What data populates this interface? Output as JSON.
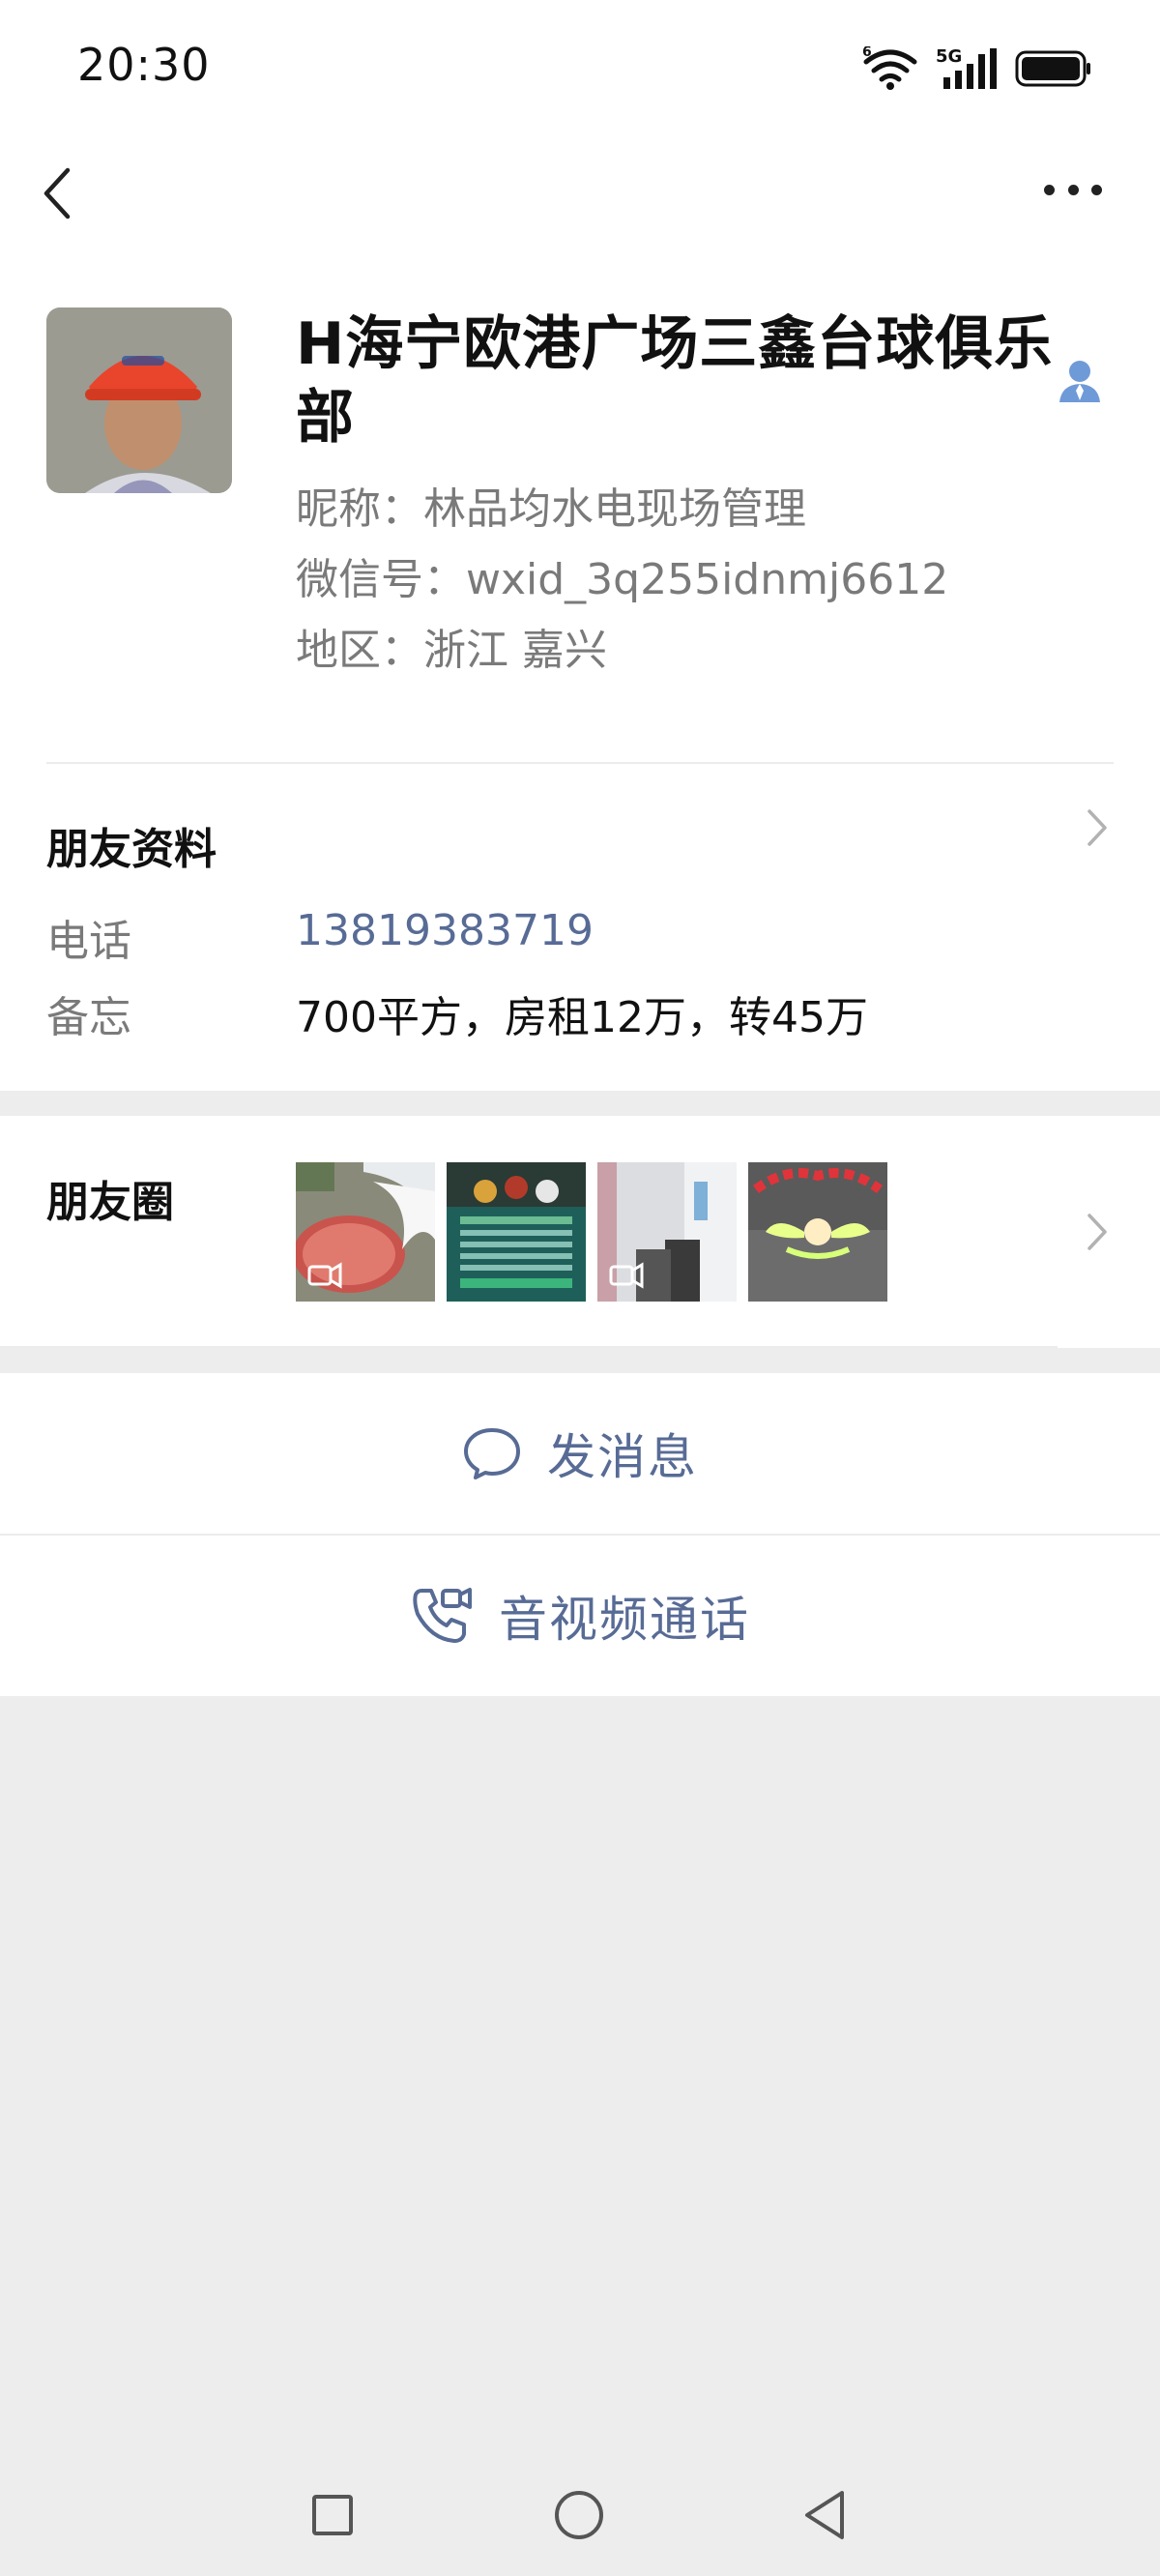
{
  "status_bar": {
    "time": "20:30",
    "network": "5G",
    "wifi_badge": "6",
    "icons": [
      "wifi-icon",
      "signal-icon",
      "battery-icon"
    ]
  },
  "header": {
    "back_icon": "chevron-left-icon",
    "more_icon": "more-dots-icon"
  },
  "profile": {
    "name": "H海宁欧港广场三鑫台球俱乐部",
    "nickname": "昵称：林品均水电现场管理",
    "wechat_id": "微信号：wxid_3q255idnmj6612",
    "region": "地区：浙江  嘉兴",
    "badge_icon": "contact-person-icon"
  },
  "friend_info": {
    "title": "朋友资料",
    "phone_label": "电话",
    "phone_value": "13819383719",
    "memo_label": "备忘",
    "memo_value": "700平方，房租12万，转45万"
  },
  "moments": {
    "title": "朋友圈",
    "thumbnails": [
      "moment-video-thumbnail",
      "moment-image-thumbnail",
      "moment-video-thumbnail",
      "moment-image-thumbnail"
    ]
  },
  "actions": {
    "send_message": "发消息",
    "av_call": "音视频通话"
  },
  "colors": {
    "accent": "#576b95",
    "background": "#ededed",
    "card": "#ffffff"
  }
}
